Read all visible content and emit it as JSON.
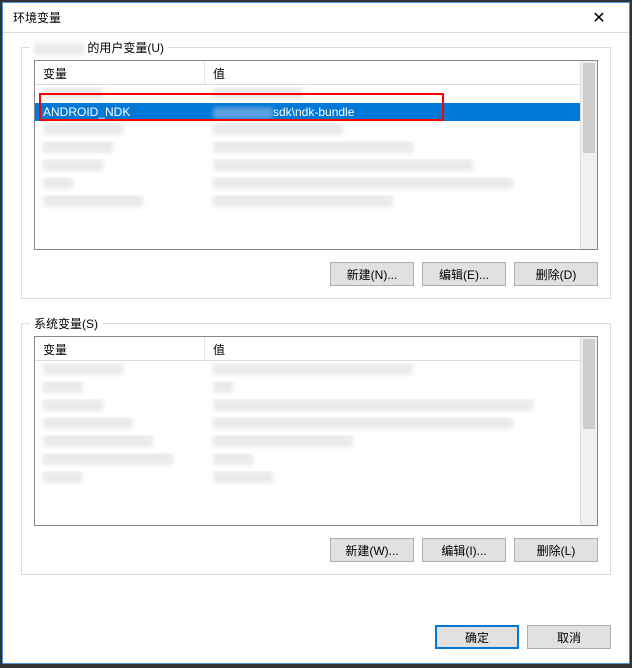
{
  "window": {
    "title": "环境变量"
  },
  "user_section": {
    "label_suffix": "的用户变量(U)",
    "columns": {
      "var": "变量",
      "val": "值"
    },
    "selected_row": {
      "var": "ANDROID_NDK",
      "val": "sdk\\ndk-bundle"
    },
    "buttons": {
      "new": "新建(N)...",
      "edit": "编辑(E)...",
      "delete": "删除(D)"
    }
  },
  "system_section": {
    "label": "系统变量(S)",
    "columns": {
      "var": "变量",
      "val": "值"
    },
    "buttons": {
      "new": "新建(W)...",
      "edit": "编辑(I)...",
      "delete": "删除(L)"
    }
  },
  "footer": {
    "ok": "确定",
    "cancel": "取消"
  }
}
